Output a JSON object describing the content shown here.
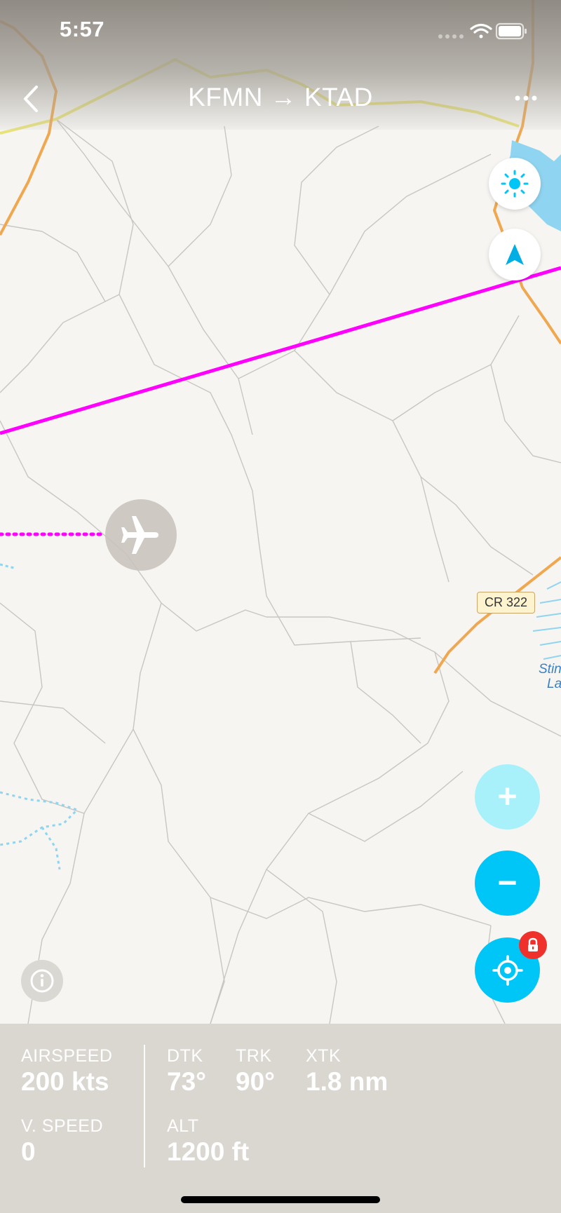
{
  "status_bar": {
    "time": "5:57",
    "icons": [
      "signal-icon",
      "wifi-icon",
      "battery-icon"
    ]
  },
  "header": {
    "title": "KFMN → KTAD",
    "back_icon": "chevron-left-icon",
    "more_icon": "ellipsis-icon"
  },
  "map": {
    "road_label": "CR 322",
    "lake_label_line1": "Stin",
    "lake_label_line2": "La",
    "route_color": "#ff00ff",
    "water_color": "#8fd4f0"
  },
  "controls": {
    "brightness_icon": "sun-icon",
    "north_icon": "north-arrow-icon",
    "zoom_in_label": "+",
    "zoom_out_label": "−",
    "locate_icon": "crosshair-icon",
    "lock_icon": "lock-icon",
    "info_icon": "info-icon",
    "accent_color": "#00c6f8"
  },
  "flight_data": {
    "airspeed": {
      "label": "AIRSPEED",
      "value": "200 kts"
    },
    "vspeed": {
      "label": "V. SPEED",
      "value": "0"
    },
    "dtk": {
      "label": "DTK",
      "value": "73°"
    },
    "trk": {
      "label": "TRK",
      "value": "90°"
    },
    "xtk": {
      "label": "XTK",
      "value": "1.8 nm"
    },
    "alt": {
      "label": "ALT",
      "value": "1200 ft"
    }
  }
}
